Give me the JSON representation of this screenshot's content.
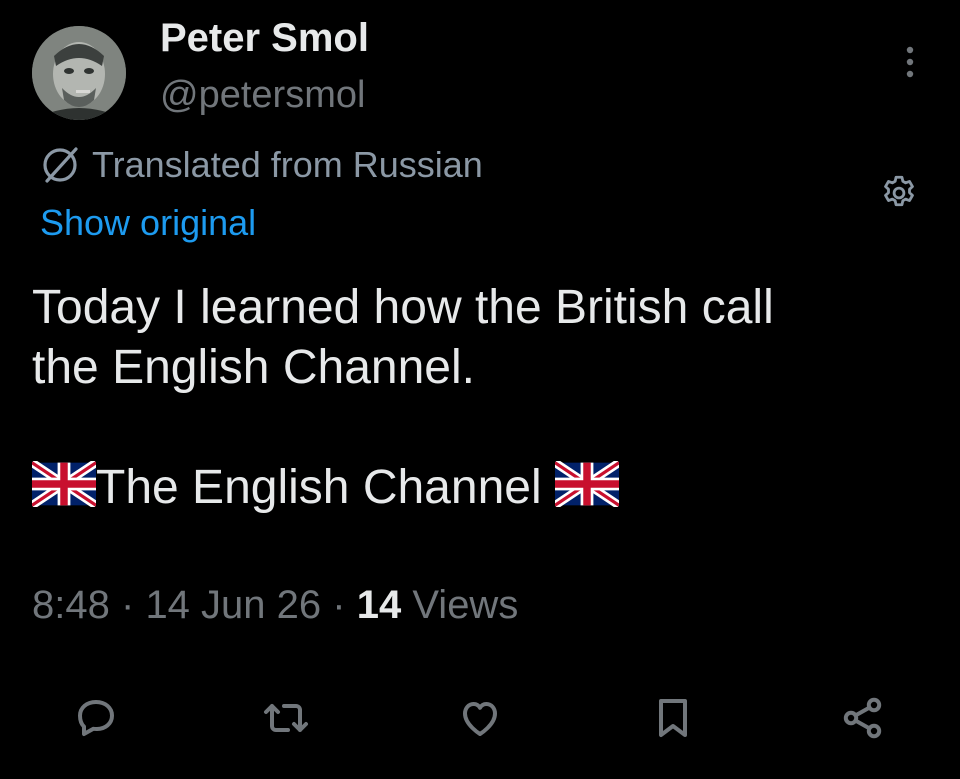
{
  "author": {
    "display_name": "Peter Smol",
    "handle": "@petersmol"
  },
  "translation": {
    "note": "Translated from Russian",
    "show_original": "Show original"
  },
  "tweet": {
    "line1": "Today I learned how the British call",
    "line2": "the English Channel.",
    "line3": "The English Channel"
  },
  "meta": {
    "time": "8:48",
    "sep1": "·",
    "date": "14 Jun 26",
    "sep2": "·",
    "views_count": "14",
    "views_label": "Views"
  },
  "icons": {
    "more": "more-vertical-icon",
    "translate": "translate-slash-icon",
    "settings": "gear-icon",
    "reply": "reply-icon",
    "retweet": "retweet-icon",
    "like": "heart-icon",
    "bookmark": "bookmark-icon",
    "share": "share-icon",
    "flag": "uk-flag-icon"
  },
  "colors": {
    "background": "#000000",
    "text": "#e7e9ea",
    "secondary": "#71767b",
    "link": "#1d9bf0",
    "translated": "#8b98a5"
  }
}
